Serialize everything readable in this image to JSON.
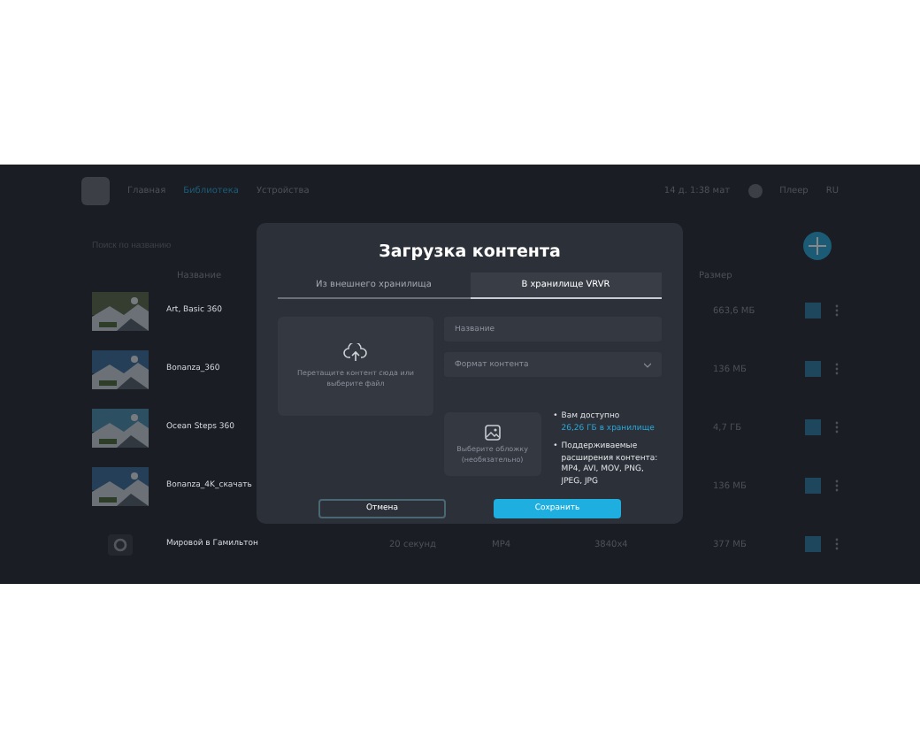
{
  "header": {
    "nav": [
      {
        "label": "Главная",
        "selected": false
      },
      {
        "label": "Библиотека",
        "selected": true
      },
      {
        "label": "Устройства",
        "selected": false
      }
    ],
    "storage": "14 д. 1:38 мат",
    "user": "Плеер",
    "language": "RU"
  },
  "search": {
    "placeholder": "Поиск по названию"
  },
  "table": {
    "columns": [
      "Название",
      "Размер"
    ],
    "rows": [
      {
        "name": "Art, Basic 360",
        "size": "663,6 МБ"
      },
      {
        "name": "Bonanza_360",
        "size": "136 МБ"
      },
      {
        "name": "Ocean Steps 360",
        "size": "4,7 ГБ"
      },
      {
        "name": "Bonanza_4K_скачать",
        "size": "136 МБ"
      },
      {
        "name": "Мировой в Гамильтон",
        "size": "377 МБ",
        "duration": "20 секунд",
        "format": "MP4",
        "resolution": "3840x4"
      }
    ]
  },
  "modal": {
    "title": "Загрузка контента",
    "tabs": [
      {
        "label": "Из внешнего хранилища",
        "selected": false
      },
      {
        "label": "В хранилище VRVR",
        "selected": true
      }
    ],
    "dropzone": "Перетащите контент сюда или выберите файл",
    "name_field": {
      "placeholder": "Название"
    },
    "format_select": {
      "placeholder": "Формат контента"
    },
    "cover": "Выберите обложку (необязательно)",
    "notes": [
      {
        "marker": "•",
        "text": "Вам доступно ",
        "link": "26,26 ГБ в хранилище"
      },
      {
        "marker": "•",
        "text": "Поддерживаемые расширения контента: MP4, AVI, MOV, PNG, JPEG, JPG"
      }
    ],
    "buttons": [
      {
        "label": "Отмена",
        "kind": "secondary"
      },
      {
        "label": "Сохранить",
        "kind": "primary"
      }
    ]
  }
}
